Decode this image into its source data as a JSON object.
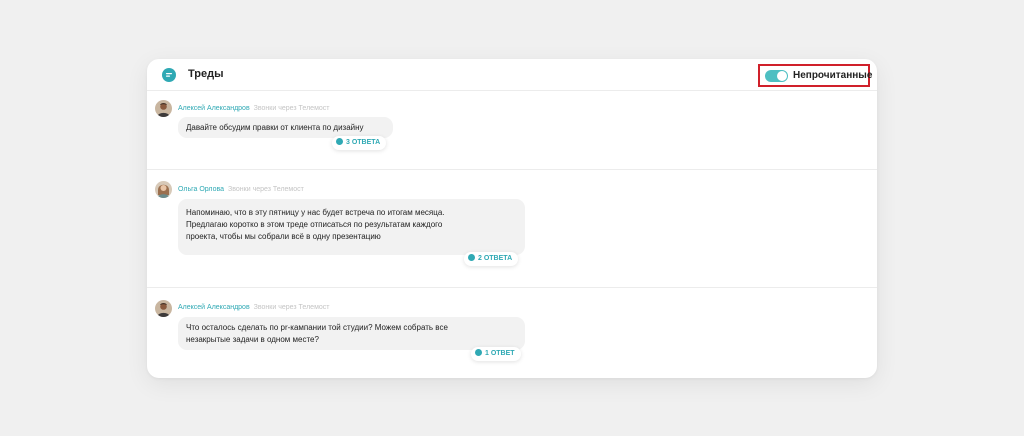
{
  "header": {
    "title": "Треды",
    "toggle_label": "Непрочитанные",
    "toggle_on": true
  },
  "threads": [
    {
      "author": "Алексей Александров",
      "channel": "Звонки через Телемост",
      "lines": [
        "Давайте обсудим правки от клиента по дизайну"
      ],
      "replies": "3 ОТВЕТА",
      "avatar": "avatar-male"
    },
    {
      "author": "Ольга Орлова",
      "channel": "Звонки через Телемост",
      "lines": [
        "Напоминаю, что в эту пятницу у нас будет встреча по итогам месяца.",
        "Предлагаю коротко в этом треде отписаться по результатам каждого",
        "проекта, чтобы мы собрали всё в одну презентацию"
      ],
      "replies": "2 ОТВЕТА",
      "avatar": "avatar-female"
    },
    {
      "author": "Алексей Александров",
      "channel": "Звонки через Телемост",
      "lines": [
        "Что осталось сделать по pr-кампании той студии? Можем собрать все",
        "незакрытые задачи в одном месте?"
      ],
      "replies": "1 ОТВЕТ",
      "avatar": "avatar-male"
    }
  ],
  "colors": {
    "accent": "#2fa9b4",
    "toggle": "#4dbfc2",
    "highlight_border": "#d0202a",
    "bubble": "#f2f2f2",
    "background": "#f0f0f0"
  }
}
